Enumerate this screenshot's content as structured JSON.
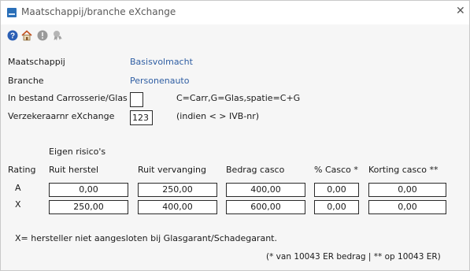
{
  "window": {
    "title": "Maatschappij/branche eXchange"
  },
  "toolbar": {
    "icons": [
      "help-icon",
      "home-icon",
      "info-icon",
      "badge-icon"
    ]
  },
  "form": {
    "maatschappij_label": "Maatschappij",
    "maatschappij_value": "Basisvolmacht",
    "branche_label": "Branche",
    "branche_value": "Personenauto",
    "carrosserie_label": "In bestand Carrosserie/Glas",
    "carrosserie_value": "",
    "carrosserie_hint": "C=Carr,G=Glas,spatie=C+G",
    "verzekeraar_label": "Verzekeraarnr eXchange",
    "verzekeraar_value": "123",
    "verzekeraar_hint": "(indien < > IVB-nr)"
  },
  "risico": {
    "section_title": "Eigen risico's",
    "headers": [
      "Rating",
      "Ruit herstel",
      "Ruit vervanging",
      "Bedrag casco",
      "% Casco *",
      "Korting casco **"
    ],
    "rows": [
      {
        "rating": "A",
        "ruit_herstel": "0,00",
        "ruit_vervanging": "250,00",
        "bedrag_casco": "400,00",
        "pct_casco": "0,00",
        "korting_casco": "0,00"
      },
      {
        "rating": "X",
        "ruit_herstel": "250,00",
        "ruit_vervanging": "400,00",
        "bedrag_casco": "600,00",
        "pct_casco": "0,00",
        "korting_casco": "0,00"
      }
    ]
  },
  "notes": {
    "x_note": "X= hersteller niet aangesloten bij Glasgarant/Schadegarant.",
    "footnote": "(* van 10043 ER bedrag | ** op 10043 ER)"
  },
  "colors": {
    "value_blue": "#2f5ea3",
    "app_icon": "#2a6fb8"
  }
}
